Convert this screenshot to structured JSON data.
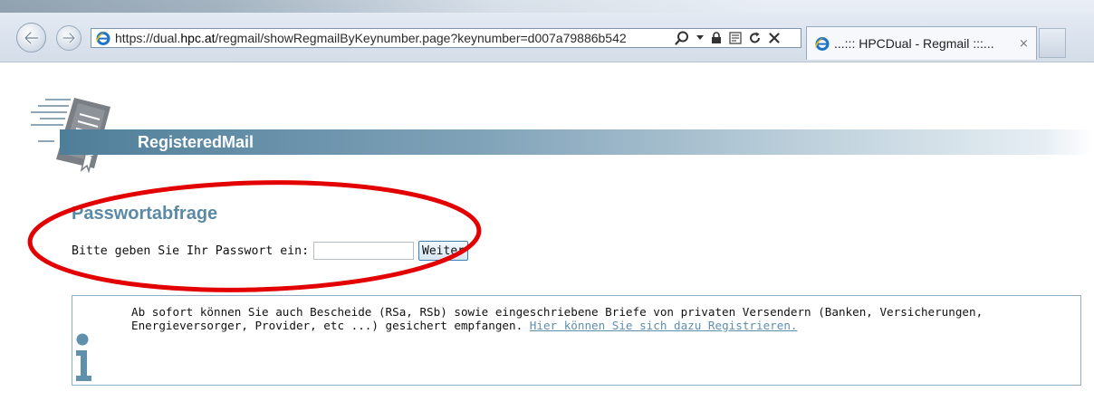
{
  "browser": {
    "url_prefix": "https://dual.",
    "url_domain": "hpc.at",
    "url_path": "/regmail/showRegmailByKeynumber.page?keynumber=d007a79886b542",
    "tab_title": "...::: HPCDual - Regmail :::...",
    "tab_close": "×",
    "icons": [
      "back-icon",
      "forward-icon",
      "ie-logo-icon",
      "search-icon",
      "dropdown-icon",
      "lock-icon",
      "compat-icon",
      "refresh-icon",
      "stop-icon",
      "tab-close-icon"
    ]
  },
  "header": {
    "title": "RegisteredMail"
  },
  "password_prompt": {
    "heading": "Passwortabfrage",
    "label": "Bitte geben Sie Ihr Passwort ein:",
    "input_value": "",
    "button_label": "Weiter"
  },
  "info": {
    "text": "Ab sofort können Sie auch Bescheide (RSa, RSb) sowie eingeschriebene Briefe von privaten Versendern (Banken, Versicherungen, Energieversorger, Provider, etc ...) gesichert empfangen.",
    "link_text": "Hier können Sie sich dazu Registrieren."
  },
  "colors": {
    "banner": "#4f7e99",
    "heading": "#5b8aa4",
    "link": "#5c8fac",
    "highlight_ellipse": "#e30000"
  }
}
